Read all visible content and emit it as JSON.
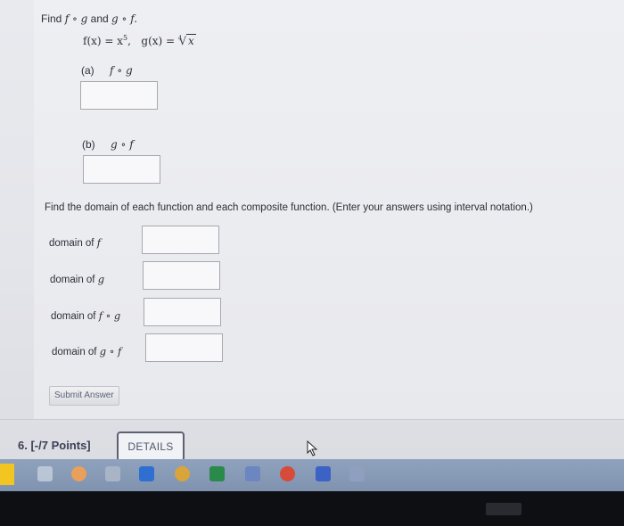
{
  "problem": {
    "intro_prefix": "Find",
    "intro_fog": "f ∘ g",
    "intro_and": "and",
    "intro_gof": "g ∘ f.",
    "f_def": "f(x) = x",
    "f_exp": "5",
    "g_def": "g(x) = ",
    "root_index": "4",
    "root_radicand": "x",
    "part_a_label": "(a)",
    "part_a_expr": "f ∘ g",
    "part_b_label": "(b)",
    "part_b_expr": "g ∘ f"
  },
  "domain_section": {
    "instruction": "Find the domain of each function and each composite function. (Enter your answers using interval notation.)",
    "items": [
      {
        "label": "domain of",
        "fn": "f"
      },
      {
        "label": "domain of",
        "fn": "g"
      },
      {
        "label": "domain of",
        "fn": "f ∘ g"
      },
      {
        "label": "domain of",
        "fn": "g ∘ f"
      }
    ]
  },
  "submit_label": "Submit Answer",
  "next_question": {
    "number": "6.",
    "points": "[-/7 Points]",
    "details_label": "DETAILS"
  },
  "taskbar": {
    "icons": [
      "folder-icon",
      "store-icon",
      "browser-icon",
      "outlook-icon",
      "chrome-icon",
      "excel-icon",
      "word-icon",
      "app-icon",
      "teams-icon",
      "onenote-icon"
    ]
  },
  "colors": {
    "taskbar": "#8fa2bd",
    "button_border": "#5b6172",
    "input_border": "#a7a9b0"
  }
}
